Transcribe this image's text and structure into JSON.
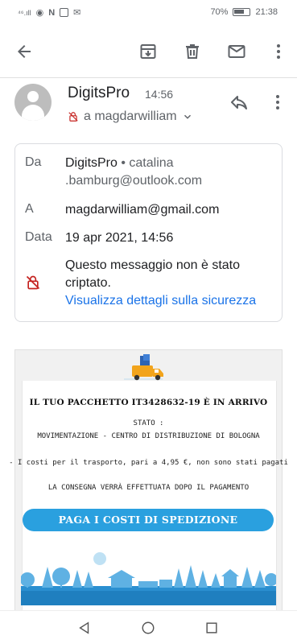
{
  "status_bar": {
    "battery": "70%",
    "time": "21:38"
  },
  "email": {
    "sender_name": "DigitsPro",
    "sent_time": "14:56",
    "recipient_line": "a magdarwilliam"
  },
  "details": {
    "from_label": "Da",
    "from_name": "DigitsPro",
    "from_email": "• catalina .bamburg@outlook.com",
    "to_label": "A",
    "to_value": "magdarwilliam@gmail.com",
    "date_label": "Data",
    "date_value": "19 apr 2021, 14:56",
    "encryption_text": "Questo messaggio non è stato criptato.",
    "security_link": "Visualizza dettagli sulla sicurezza"
  },
  "body": {
    "title": "IL TUO PACCHETTO IT3428632-19 È IN ARRIVO",
    "status_label": "STATO :",
    "status_value": "MOVIMENTAZIONE - CENTRO DI DISTRIBUZIONE DI BOLOGNA",
    "fees_note": "- I costi per il trasporto, pari a 4,95 €, non sono stati pagati",
    "delivery_note": "LA CONSEGNA VERRÀ EFFETTUATA DOPO IL PAGAMENTO",
    "pay_button": "PAGA I COSTI DI SPEDIZIONE"
  },
  "colors": {
    "link": "#1a73e8",
    "pay_button": "#2aa0df",
    "unencrypted_lock": "#c5221f"
  }
}
